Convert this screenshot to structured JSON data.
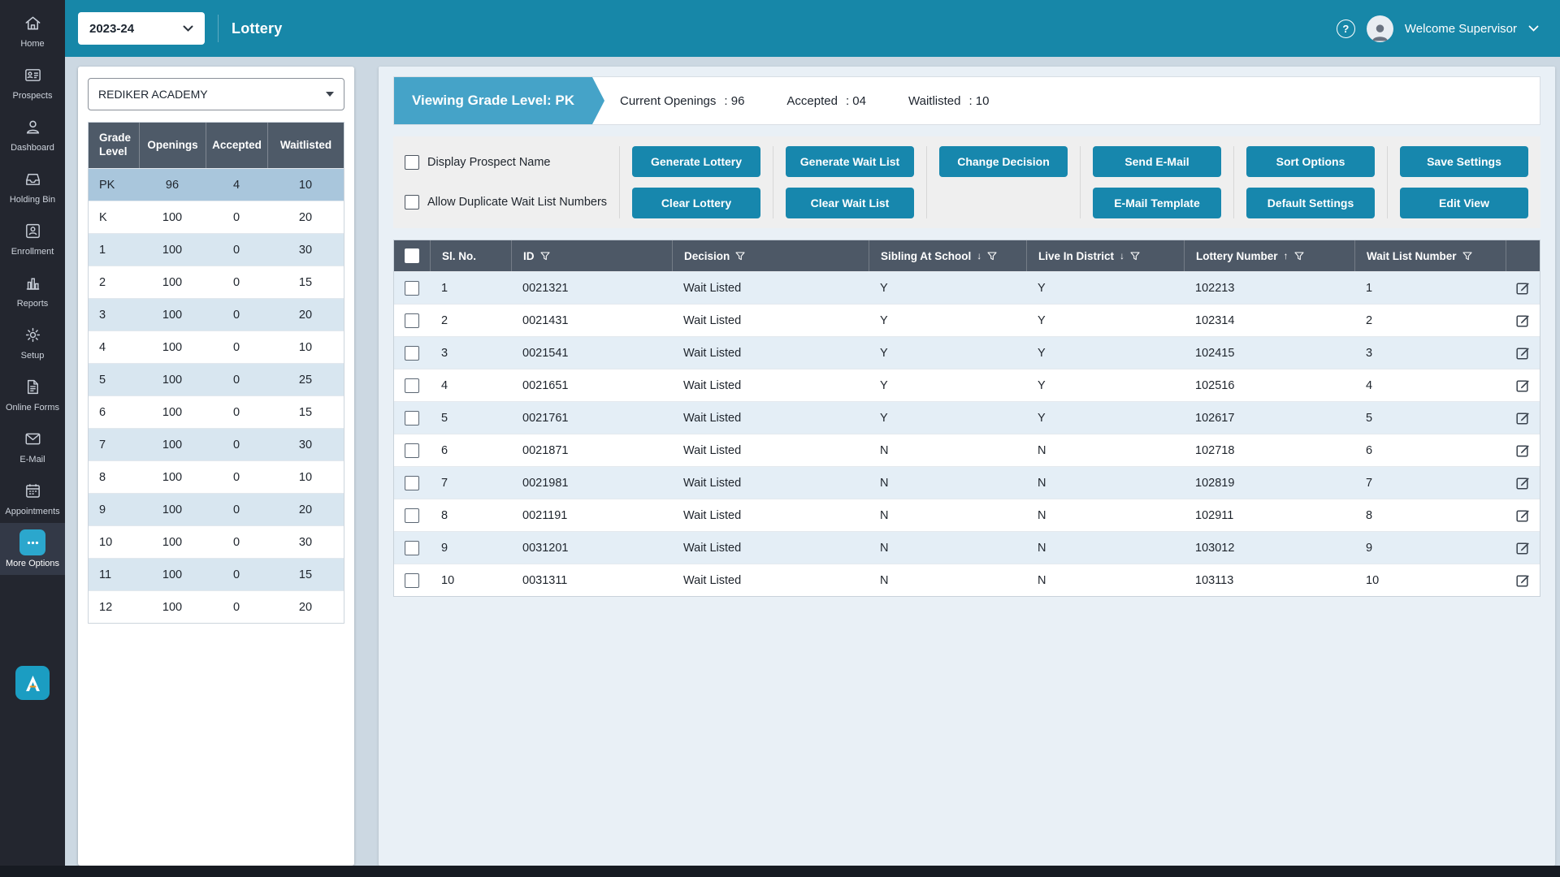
{
  "topbar": {
    "year": "2023-24",
    "title": "Lottery",
    "help": "?",
    "welcome": "Welcome Supervisor"
  },
  "sidebar": {
    "items": [
      {
        "label": "Home",
        "icon": "home-icon",
        "selected": false
      },
      {
        "label": "Prospects",
        "icon": "prospects-icon",
        "selected": false
      },
      {
        "label": "Dashboard",
        "icon": "dashboard-icon",
        "selected": false
      },
      {
        "label": "Holding Bin",
        "icon": "holding-bin-icon",
        "selected": false
      },
      {
        "label": "Enrollment",
        "icon": "enrollment-icon",
        "selected": false
      },
      {
        "label": "Reports",
        "icon": "reports-icon",
        "selected": false
      },
      {
        "label": "Setup",
        "icon": "setup-icon",
        "selected": false
      },
      {
        "label": "Online Forms",
        "icon": "online-forms-icon",
        "selected": false
      },
      {
        "label": "E-Mail",
        "icon": "email-icon",
        "selected": false
      },
      {
        "label": "Appointments",
        "icon": "appointments-icon",
        "selected": false
      },
      {
        "label": "More Options",
        "icon": "more-options-icon",
        "selected": true
      }
    ]
  },
  "left_panel": {
    "school_select": "REDIKER ACADEMY",
    "grade_table": {
      "headers": [
        "Grade Level",
        "Openings",
        "Accepted",
        "Waitlisted"
      ],
      "rows": [
        {
          "grade": "PK",
          "openings": "96",
          "accepted": "4",
          "waitlisted": "10",
          "selected": true
        },
        {
          "grade": "K",
          "openings": "100",
          "accepted": "0",
          "waitlisted": "20",
          "selected": false
        },
        {
          "grade": "1",
          "openings": "100",
          "accepted": "0",
          "waitlisted": "30",
          "selected": false
        },
        {
          "grade": "2",
          "openings": "100",
          "accepted": "0",
          "waitlisted": "15",
          "selected": false
        },
        {
          "grade": "3",
          "openings": "100",
          "accepted": "0",
          "waitlisted": "20",
          "selected": false
        },
        {
          "grade": "4",
          "openings": "100",
          "accepted": "0",
          "waitlisted": "10",
          "selected": false
        },
        {
          "grade": "5",
          "openings": "100",
          "accepted": "0",
          "waitlisted": "25",
          "selected": false
        },
        {
          "grade": "6",
          "openings": "100",
          "accepted": "0",
          "waitlisted": "15",
          "selected": false
        },
        {
          "grade": "7",
          "openings": "100",
          "accepted": "0",
          "waitlisted": "30",
          "selected": false
        },
        {
          "grade": "8",
          "openings": "100",
          "accepted": "0",
          "waitlisted": "10",
          "selected": false
        },
        {
          "grade": "9",
          "openings": "100",
          "accepted": "0",
          "waitlisted": "20",
          "selected": false
        },
        {
          "grade": "10",
          "openings": "100",
          "accepted": "0",
          "waitlisted": "30",
          "selected": false
        },
        {
          "grade": "11",
          "openings": "100",
          "accepted": "0",
          "waitlisted": "15",
          "selected": false
        },
        {
          "grade": "12",
          "openings": "100",
          "accepted": "0",
          "waitlisted": "20",
          "selected": false
        }
      ]
    }
  },
  "main": {
    "viewing_tab": "Viewing Grade Level: PK",
    "stats": [
      {
        "label": "Current Openings",
        "value": ": 96"
      },
      {
        "label": "Accepted",
        "value": ": 04"
      },
      {
        "label": "Waitlisted",
        "value": ": 10"
      }
    ],
    "checkboxes": [
      {
        "label": "Display Prospect Name",
        "checked": false
      },
      {
        "label": "Allow Duplicate Wait List Numbers",
        "checked": false
      }
    ],
    "button_groups": [
      {
        "top": "Generate Lottery",
        "bottom": "Clear Lottery"
      },
      {
        "top": "Generate Wait List",
        "bottom": "Clear Wait List"
      },
      {
        "top": "Change Decision",
        "bottom": null
      },
      {
        "top": "Send E-Mail",
        "bottom": "E-Mail Template"
      },
      {
        "top": "Sort Options",
        "bottom": "Default Settings"
      },
      {
        "top": "Save Settings",
        "bottom": "Edit View"
      }
    ],
    "table": {
      "columns": [
        {
          "label": "Sl. No.",
          "sort": null,
          "filter": false
        },
        {
          "label": "ID",
          "sort": null,
          "filter": true
        },
        {
          "label": "Decision",
          "sort": null,
          "filter": true
        },
        {
          "label": "Sibling At School",
          "sort": "down",
          "filter": true
        },
        {
          "label": "Live In District",
          "sort": "down",
          "filter": true
        },
        {
          "label": "Lottery Number",
          "sort": "up",
          "filter": true
        },
        {
          "label": "Wait List Number",
          "sort": null,
          "filter": true
        }
      ],
      "rows": [
        {
          "sl": "1",
          "id": "0021321",
          "decision": "Wait Listed",
          "sibling": "Y",
          "district": "Y",
          "lottery": "102213",
          "waitlist": "1"
        },
        {
          "sl": "2",
          "id": "0021431",
          "decision": "Wait Listed",
          "sibling": "Y",
          "district": "Y",
          "lottery": "102314",
          "waitlist": "2"
        },
        {
          "sl": "3",
          "id": "0021541",
          "decision": "Wait Listed",
          "sibling": "Y",
          "district": "Y",
          "lottery": "102415",
          "waitlist": "3"
        },
        {
          "sl": "4",
          "id": "0021651",
          "decision": "Wait Listed",
          "sibling": "Y",
          "district": "Y",
          "lottery": "102516",
          "waitlist": "4"
        },
        {
          "sl": "5",
          "id": "0021761",
          "decision": "Wait Listed",
          "sibling": "Y",
          "district": "Y",
          "lottery": "102617",
          "waitlist": "5"
        },
        {
          "sl": "6",
          "id": "0021871",
          "decision": "Wait Listed",
          "sibling": "N",
          "district": "N",
          "lottery": "102718",
          "waitlist": "6"
        },
        {
          "sl": "7",
          "id": "0021981",
          "decision": "Wait Listed",
          "sibling": "N",
          "district": "N",
          "lottery": "102819",
          "waitlist": "7"
        },
        {
          "sl": "8",
          "id": "0021191",
          "decision": "Wait Listed",
          "sibling": "N",
          "district": "N",
          "lottery": "102911",
          "waitlist": "8"
        },
        {
          "sl": "9",
          "id": "0031201",
          "decision": "Wait Listed",
          "sibling": "N",
          "district": "N",
          "lottery": "103012",
          "waitlist": "9"
        },
        {
          "sl": "10",
          "id": "0031311",
          "decision": "Wait Listed",
          "sibling": "N",
          "district": "N",
          "lottery": "103113",
          "waitlist": "10"
        }
      ]
    }
  },
  "colors": {
    "accent_teal": "#1787a8",
    "button_teal": "#1787ad",
    "tab_blue": "#45a3c8",
    "sidebar_dark": "#23262f",
    "table_header_dark": "#4d5866",
    "selected_row_blue": "#a9c6dc"
  }
}
